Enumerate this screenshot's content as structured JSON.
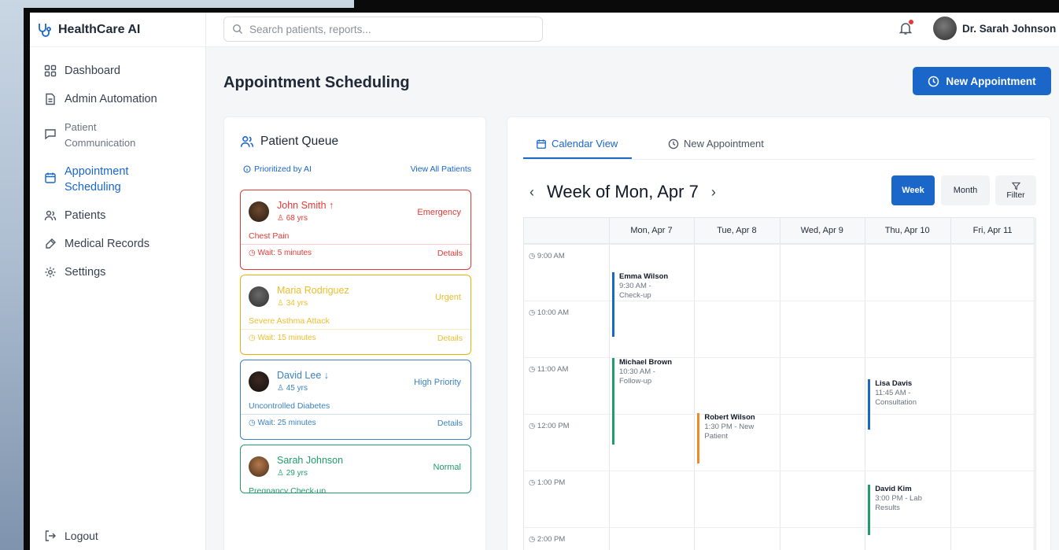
{
  "app": {
    "brand": "HealthCare AI",
    "search_placeholder": "Search patients, reports...",
    "user_name": "Dr. Sarah Johnson"
  },
  "sidebar": {
    "items": [
      {
        "label": "Dashboard",
        "icon": "grid-icon"
      },
      {
        "label": "Admin Automation",
        "icon": "document-icon"
      },
      {
        "label1": "Patient",
        "label2": "Communication",
        "icon": "message-icon"
      },
      {
        "label1": "Appointment",
        "label2": "Scheduling",
        "icon": "calendar-icon",
        "active": true
      },
      {
        "label": "Patients",
        "icon": "users-icon"
      },
      {
        "label": "Medical Records",
        "icon": "records-icon"
      },
      {
        "label": "Settings",
        "icon": "gear-icon"
      }
    ],
    "logout": "Logout"
  },
  "page": {
    "title": "Appointment Scheduling",
    "new_button": "New Appointment"
  },
  "queue": {
    "title": "Patient Queue",
    "prioritized": "Prioritized by AI",
    "view_all": "View All Patients",
    "cards": [
      {
        "name": "John Smith",
        "trend": "↑",
        "age": "68 yrs",
        "level": "Emergency",
        "condition": "Chest Pain",
        "wait": "Wait: 5 minutes",
        "details": "Details",
        "color": "#e53935",
        "bg": "#fff"
      },
      {
        "name": "Maria Rodriguez",
        "trend": "",
        "age": "34 yrs",
        "level": "Urgent",
        "condition": "Severe Asthma Attack",
        "wait": "Wait: 15 minutes",
        "details": "Details",
        "color": "#e9b208",
        "bg": "#fff"
      },
      {
        "name": "David Lee",
        "trend": "↓",
        "age": "45 yrs",
        "level": "High Priority",
        "condition": "Uncontrolled Diabetes",
        "wait": "Wait: 25 minutes",
        "details": "Details",
        "color": "#3b82c4",
        "bg": "#fff"
      },
      {
        "name": "Sarah Johnson",
        "trend": "",
        "age": "29 yrs",
        "level": "Normal",
        "condition": "Pregnancy Check-up",
        "wait": "",
        "details": "",
        "color": "#1f9d6b",
        "bg": "#fff"
      }
    ]
  },
  "calendar": {
    "tabs": {
      "calendar": "Calendar View",
      "new": "New Appointment"
    },
    "week_title": "Week of Mon, Apr 7",
    "prev": "‹",
    "next": "›",
    "btn_week": "Week",
    "btn_month": "Month",
    "btn_filter": "Filter",
    "days": [
      "Mon, Apr 7",
      "Tue, Apr 8",
      "Wed, Apr 9",
      "Thu, Apr 10",
      "Fri, Apr 11"
    ],
    "times": [
      "9:00 AM",
      "10:00 AM",
      "11:00 AM",
      "12:00 PM",
      "1:00 PM",
      "2:00 PM"
    ],
    "events": [
      {
        "name": "Emma Wilson",
        "time": "9:30 AM -",
        "type": "Check-up",
        "color": "#1a66c9"
      },
      {
        "name": "Michael Brown",
        "time": "10:30 AM -",
        "type": "Follow-up",
        "color": "#1f9d6b"
      },
      {
        "name": "Robert Wilson",
        "time": "1:30 PM - New",
        "type": "Patient",
        "color": "#f08a24"
      },
      {
        "name": "Lisa Davis",
        "time": "11:45 AM -",
        "type": "Consultation",
        "color": "#1a66c9"
      },
      {
        "name": "David Kim",
        "time": "3:00 PM - Lab",
        "type": "Results",
        "color": "#1f9d6b"
      }
    ]
  }
}
